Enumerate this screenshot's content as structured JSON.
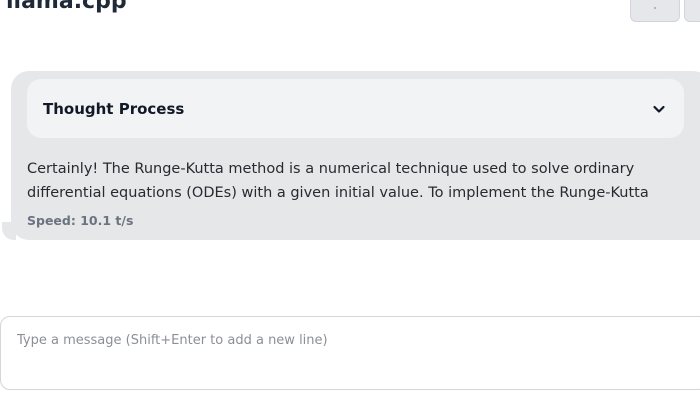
{
  "app": {
    "title": "llama.cpp"
  },
  "header": {
    "buttons": [
      {
        "icon": "menu-dot-icon"
      },
      {
        "icon": "settings-icon"
      }
    ]
  },
  "message": {
    "thought_process": {
      "title": "Thought Process",
      "icon": "chevron-down-icon"
    },
    "text": "Certainly! The Runge-Kutta method is a numerical technique used to solve ordinary\ndifferential equations (ODEs) with a given initial value. To implement the Runge-Kutta",
    "speed": "Speed: 10.1 t/s"
  },
  "composer": {
    "placeholder": "Type a message (Shift+Enter to add a new line)",
    "value": ""
  },
  "colors": {
    "bubble": "#e5e7e9",
    "thought_panel": "#f2f3f4",
    "text": "#272b31",
    "muted": "#6b7280"
  }
}
